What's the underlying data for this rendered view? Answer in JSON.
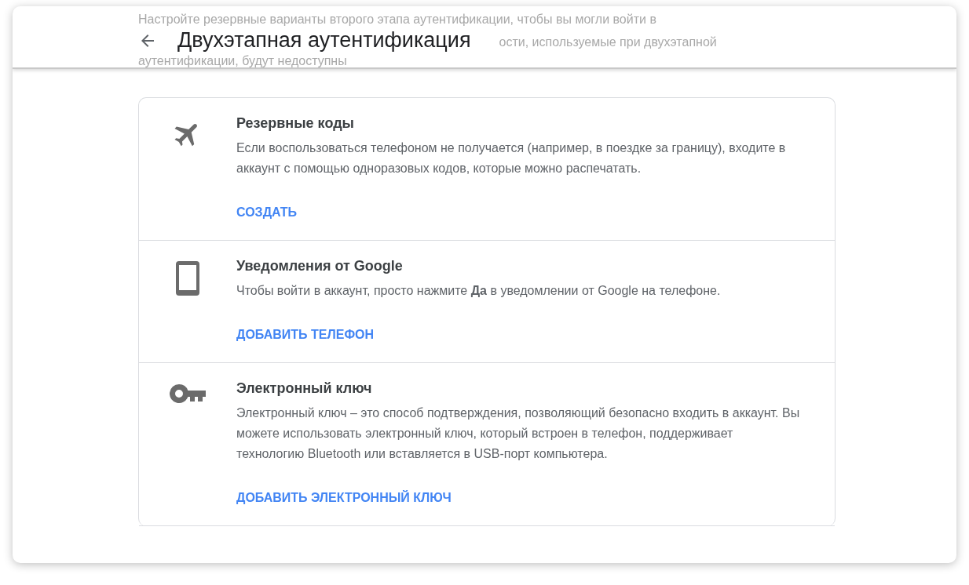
{
  "header": {
    "title": "Двухэтапная аутентификация",
    "intro_lines": [
      "Настройте резервные варианты второго этапа аутентификации, чтобы вы могли войти в",
      "ости, используемые при двухэтапной",
      "аутентификации, будут недоступны"
    ]
  },
  "options": [
    {
      "kind": "plane",
      "title": "Резервные коды",
      "description": "Если воспользоваться телефоном не получается (например, в поездке за границу), входите в аккаунт с помощью одноразовых кодов, которые можно распечатать.",
      "action": "СОЗДАТЬ"
    },
    {
      "kind": "phone",
      "title": "Уведомления от Google",
      "description": "Чтобы войти в аккаунт, просто нажмите **Да** в уведомлении от Google на телефоне.",
      "action": "ДОБАВИТЬ ТЕЛЕФОН"
    },
    {
      "kind": "key",
      "title": "Электронный ключ",
      "description": "Электронный ключ – это способ подтверждения, позволяющий безопасно входить в аккаунт. Вы можете использовать электронный ключ, который встроен в телефон, поддерживает технологию Bluetooth или вставляется в USB-порт компьютера.",
      "action": "ДОБАВИТЬ ЭЛЕКТРОННЫЙ КЛЮЧ"
    }
  ]
}
